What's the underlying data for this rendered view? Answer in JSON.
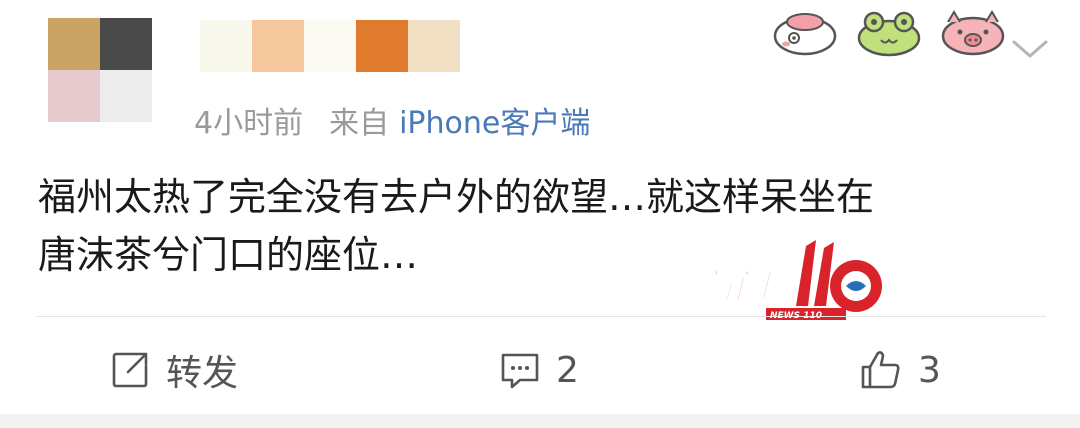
{
  "post": {
    "time": "4小时前",
    "source_prefix": "来自",
    "source_device": "iPhone客户端",
    "text_line1": "福州太热了完全没有去户外的欲望…就这样呆坐在",
    "text_line2": "唐沫茶兮门口的座位…"
  },
  "avatar": {
    "tiles": [
      "#c9a465",
      "#4a4a4a",
      "#e6c9cd",
      "#ececec"
    ]
  },
  "username_mosaic": {
    "tiles": [
      "#f8f8ec",
      "#f4c79d",
      "#fbfbf4",
      "#e07a2c",
      "#f1dfc3"
    ]
  },
  "stickers": [
    "pig-sticker-icon",
    "frog-sticker-icon",
    "pig-face-sticker-icon"
  ],
  "watermark": {
    "main": "新闻110",
    "sub": "NEWS 110"
  },
  "actions": {
    "repost_label": "转发",
    "comment_count": "2",
    "like_count": "3"
  }
}
